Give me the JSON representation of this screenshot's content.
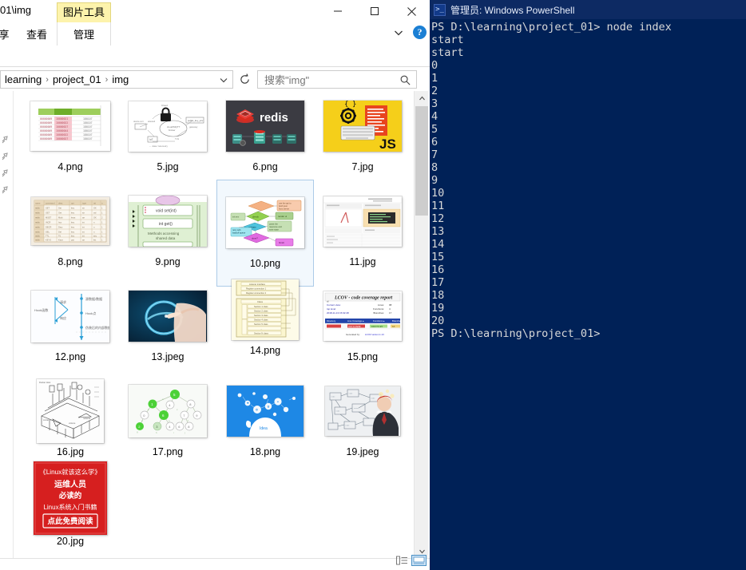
{
  "explorer": {
    "titlebar": {
      "path_text": "01\\img",
      "contextual_tab": "图片工具",
      "minimize_label": "最小化",
      "maximize_label": "最大化",
      "close_label": "关闭"
    },
    "ribbon": {
      "tabs": [
        {
          "label": "享",
          "active": false
        },
        {
          "label": "查看",
          "active": false
        },
        {
          "label": "管理",
          "active": true
        }
      ],
      "expand_label": "展开功能区",
      "help_label": "?"
    },
    "address": {
      "crumbs": [
        "learning",
        "project_01",
        "img"
      ],
      "separator": "›",
      "refresh_label": "刷新",
      "dropdown_label": "最近的位置"
    },
    "search": {
      "placeholder": "搜索\"img\"",
      "icon": "search-icon"
    },
    "quick_access_pins": [
      "pin-icon",
      "pin-icon",
      "pin-icon",
      "pin-icon"
    ],
    "files": [
      {
        "name": "4.png",
        "thumb": "spreadsheet-green"
      },
      {
        "name": "5.jpg",
        "thumb": "network-lock-diagram"
      },
      {
        "name": "6.png",
        "thumb": "redis-dark"
      },
      {
        "name": "7.jpg",
        "thumb": "js-yellow"
      },
      {
        "name": "8.png",
        "thumb": "beige-table"
      },
      {
        "name": "9.png",
        "thumb": "green-java-diagram"
      },
      {
        "name": "10.png",
        "thumb": "color-flowchart",
        "selected": true
      },
      {
        "name": "11.jpg",
        "thumb": "dashboard-screenshot"
      },
      {
        "name": "12.png",
        "thumb": "blue-sequence-diagram"
      },
      {
        "name": "13.jpeg",
        "thumb": "hand-circle-blue"
      },
      {
        "name": "14.png",
        "thumb": "cream-block-diagram"
      },
      {
        "name": "15.png",
        "thumb": "lcov-report"
      },
      {
        "name": "16.jpg",
        "thumb": "isometric-sketch"
      },
      {
        "name": "17.png",
        "thumb": "green-tree-graph"
      },
      {
        "name": "18.png",
        "thumb": "blue-head-bubbles"
      },
      {
        "name": "19.jpeg",
        "thumb": "person-network"
      },
      {
        "name": "20.jpg",
        "thumb": "red-linux-ad"
      }
    ],
    "thumb_text": {
      "redis": "redis",
      "js": "JS",
      "java_method": "void set(int)",
      "java_get": "int get()",
      "java_caption": "Methods accessing shared data",
      "lcov_title": "LCOV - code coverage report",
      "lcov_lines": "Lines:",
      "lcov_functions": "Functions:",
      "lcov_branches": "Branches:",
      "linux_l1": "《Linux就该这么学》",
      "linux_l2": "运维人员",
      "linux_l3": "必读的",
      "linux_l4": "Linux系统入门书籍",
      "linux_btn": "点此免费阅读"
    },
    "statusbar": {
      "details_view_label": "详细信息",
      "large_icons_view_label": "大图标"
    },
    "scrollbar": {
      "up_label": "向上滚动",
      "down_label": "向下滚动"
    }
  },
  "powershell": {
    "title": "管理员: Windows PowerShell",
    "icon": "powershell-icon",
    "lines": [
      "PS D:\\learning\\project_01> node index",
      "start",
      "start",
      "0",
      "1",
      "2",
      "3",
      "4",
      "5",
      "6",
      "7",
      "8",
      "9",
      "10",
      "11",
      "12",
      "13",
      "14",
      "15",
      "16",
      "17",
      "18",
      "19",
      "20",
      "PS D:\\learning\\project_01>"
    ]
  },
  "colors": {
    "ps_background": "#002157",
    "ps_titlebar": "#0d2a63",
    "ps_text": "#d9d9d9",
    "contextual_tab": "#fdf3ac",
    "selection": "#f2f8fd",
    "selection_border": "#accbe8",
    "help_blue": "#1b7fd4"
  }
}
